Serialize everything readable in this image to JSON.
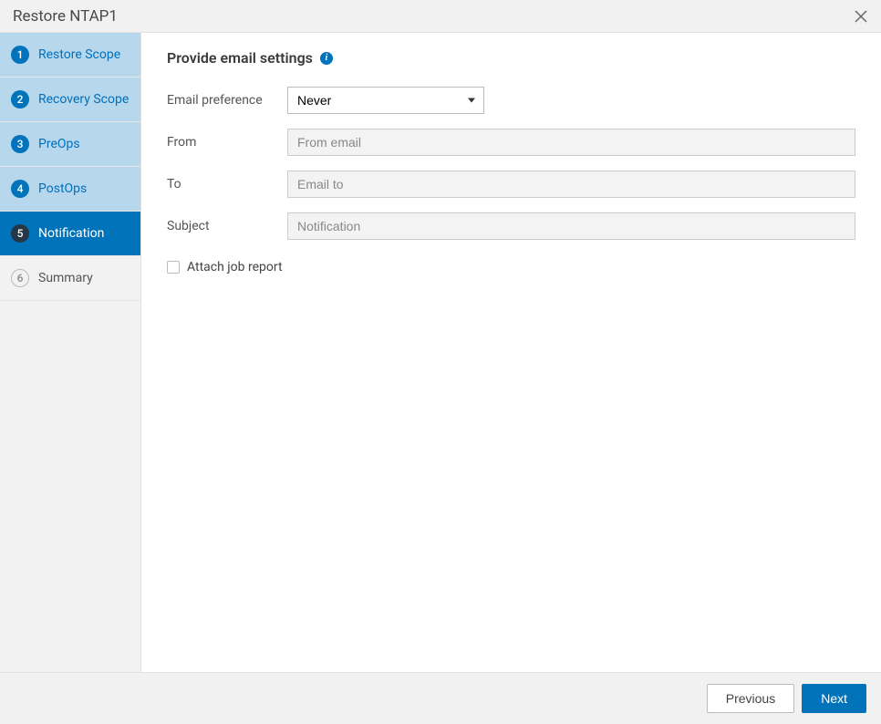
{
  "header": {
    "title": "Restore NTAP1"
  },
  "sidebar": {
    "steps": [
      {
        "number": "1",
        "label": "Restore Scope",
        "state": "completed"
      },
      {
        "number": "2",
        "label": "Recovery Scope",
        "state": "completed"
      },
      {
        "number": "3",
        "label": "PreOps",
        "state": "completed"
      },
      {
        "number": "4",
        "label": "PostOps",
        "state": "completed"
      },
      {
        "number": "5",
        "label": "Notification",
        "state": "active"
      },
      {
        "number": "6",
        "label": "Summary",
        "state": "pending"
      }
    ]
  },
  "main": {
    "heading": "Provide email settings",
    "fields": {
      "email_preference": {
        "label": "Email preference",
        "value": "Never"
      },
      "from": {
        "label": "From",
        "placeholder": "From email",
        "value": ""
      },
      "to": {
        "label": "To",
        "placeholder": "Email to",
        "value": ""
      },
      "subject": {
        "label": "Subject",
        "placeholder": "Notification",
        "value": ""
      }
    },
    "attach_job_report": {
      "label": "Attach job report",
      "checked": false
    }
  },
  "footer": {
    "previous": "Previous",
    "next": "Next"
  }
}
